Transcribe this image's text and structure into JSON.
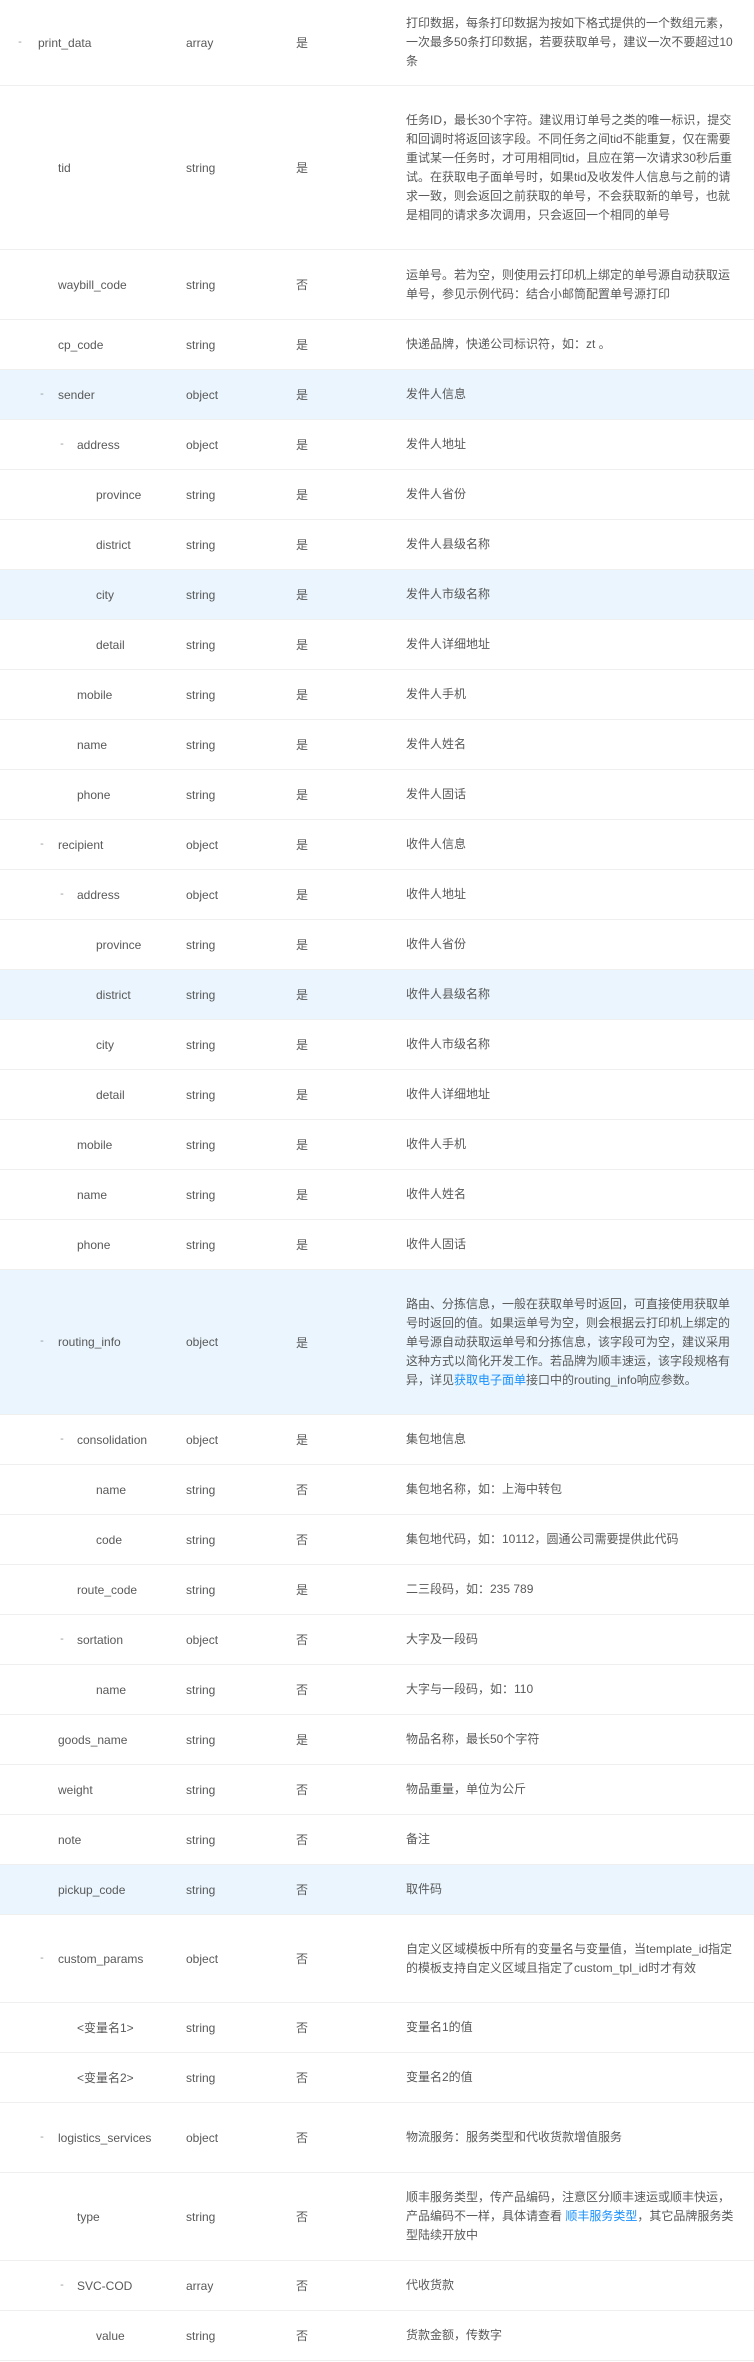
{
  "rows": [
    {
      "name": "print_data",
      "level": 0,
      "toggle": "-",
      "type": "array",
      "required": "是",
      "desc": [
        "打印数据，每条打印数据为按如下格式提供的一个数组元素，一次最多50条打印数据，若要获取单号，建议一次不要超过10条"
      ],
      "h": 86
    },
    {
      "name": "tid",
      "level": 1,
      "toggle": "",
      "type": "string",
      "required": "是",
      "desc": [
        "任务ID，最长30个字符。建议用订单号之类的唯一标识，提交和回调时将返回该字段。不同任务之间tid不能重复，仅在需要重试某一任务时，才可用相同tid，且应在第一次请求30秒后重试。在获取电子面单号时，如果tid及收发件人信息与之前的请求一致，则会返回之前获取的单号，不会获取新的单号，也就是相同的请求多次调用，只会返回一个相同的单号"
      ],
      "h": 164
    },
    {
      "name": "waybill_code",
      "level": 1,
      "toggle": "",
      "type": "string",
      "required": "否",
      "desc": [
        "运单号。若为空，则使用云打印机上绑定的单号源自动获取运单号，参见示例代码：结合小邮筒配置单号源打印"
      ],
      "h": 70
    },
    {
      "name": "cp_code",
      "level": 1,
      "toggle": "",
      "type": "string",
      "required": "是",
      "desc": [
        "快递品牌，快递公司标识符，如：zt 。"
      ],
      "h": 50
    },
    {
      "name": "sender",
      "level": 1,
      "toggle": "-",
      "type": "object",
      "required": "是",
      "desc": [
        "发件人信息"
      ],
      "h": 50,
      "hl": true
    },
    {
      "name": "address",
      "level": 2,
      "toggle": "-",
      "type": "object",
      "required": "是",
      "desc": [
        "发件人地址"
      ],
      "h": 50
    },
    {
      "name": "province",
      "level": 3,
      "toggle": "",
      "type": "string",
      "required": "是",
      "desc": [
        "发件人省份"
      ],
      "h": 50
    },
    {
      "name": "district",
      "level": 3,
      "toggle": "",
      "type": "string",
      "required": "是",
      "desc": [
        "发件人县级名称"
      ],
      "h": 50
    },
    {
      "name": "city",
      "level": 3,
      "toggle": "",
      "type": "string",
      "required": "是",
      "desc": [
        "发件人市级名称"
      ],
      "h": 50,
      "hl": true
    },
    {
      "name": "detail",
      "level": 3,
      "toggle": "",
      "type": "string",
      "required": "是",
      "desc": [
        "发件人详细地址"
      ],
      "h": 50
    },
    {
      "name": "mobile",
      "level": 2,
      "toggle": "",
      "type": "string",
      "required": "是",
      "desc": [
        "发件人手机"
      ],
      "h": 50
    },
    {
      "name": "name",
      "level": 2,
      "toggle": "",
      "type": "string",
      "required": "是",
      "desc": [
        "发件人姓名"
      ],
      "h": 50
    },
    {
      "name": "phone",
      "level": 2,
      "toggle": "",
      "type": "string",
      "required": "是",
      "desc": [
        "发件人固话"
      ],
      "h": 50
    },
    {
      "name": "recipient",
      "level": 1,
      "toggle": "-",
      "type": "object",
      "required": "是",
      "desc": [
        "收件人信息"
      ],
      "h": 50
    },
    {
      "name": "address",
      "level": 2,
      "toggle": "-",
      "type": "object",
      "required": "是",
      "desc": [
        "收件人地址"
      ],
      "h": 50
    },
    {
      "name": "province",
      "level": 3,
      "toggle": "",
      "type": "string",
      "required": "是",
      "desc": [
        "收件人省份"
      ],
      "h": 50
    },
    {
      "name": "district",
      "level": 3,
      "toggle": "",
      "type": "string",
      "required": "是",
      "desc": [
        "收件人县级名称"
      ],
      "h": 50,
      "hl": true
    },
    {
      "name": "city",
      "level": 3,
      "toggle": "",
      "type": "string",
      "required": "是",
      "desc": [
        "收件人市级名称"
      ],
      "h": 50
    },
    {
      "name": "detail",
      "level": 3,
      "toggle": "",
      "type": "string",
      "required": "是",
      "desc": [
        "收件人详细地址"
      ],
      "h": 50
    },
    {
      "name": "mobile",
      "level": 2,
      "toggle": "",
      "type": "string",
      "required": "是",
      "desc": [
        "收件人手机"
      ],
      "h": 50
    },
    {
      "name": "name",
      "level": 2,
      "toggle": "",
      "type": "string",
      "required": "是",
      "desc": [
        "收件人姓名"
      ],
      "h": 50
    },
    {
      "name": "phone",
      "level": 2,
      "toggle": "",
      "type": "string",
      "required": "是",
      "desc": [
        "收件人固话"
      ],
      "h": 50
    },
    {
      "name": "routing_info",
      "level": 1,
      "toggle": "-",
      "type": "object",
      "required": "是",
      "desc": [
        "路由、分拣信息，一般在获取单号时返回，可直接使用获取单号时返回的值。如果运单号为空，则会根据云打印机上绑定的单号源自动获取运单号和分拣信息，该字段可为空，建议采用这种方式以简化开发工作。若品牌为顺丰速运，该字段规格有异，详见",
        {
          "link": "获取电子面单"
        },
        "接口中的routing_info响应参数。"
      ],
      "h": 145,
      "hl": true
    },
    {
      "name": "consolidation",
      "level": 2,
      "toggle": "-",
      "type": "object",
      "required": "是",
      "desc": [
        "集包地信息"
      ],
      "h": 50
    },
    {
      "name": "name",
      "level": 3,
      "toggle": "",
      "type": "string",
      "required": "否",
      "desc": [
        "集包地名称，如：上海中转包"
      ],
      "h": 50
    },
    {
      "name": "code",
      "level": 3,
      "toggle": "",
      "type": "string",
      "required": "否",
      "desc": [
        "集包地代码，如：10112，圆通公司需要提供此代码"
      ],
      "h": 50
    },
    {
      "name": "route_code",
      "level": 2,
      "toggle": "",
      "type": "string",
      "required": "是",
      "desc": [
        "二三段码，如：235 789"
      ],
      "h": 50
    },
    {
      "name": "sortation",
      "level": 2,
      "toggle": "-",
      "type": "object",
      "required": "否",
      "desc": [
        "大字及一段码"
      ],
      "h": 50
    },
    {
      "name": "name",
      "level": 3,
      "toggle": "",
      "type": "string",
      "required": "否",
      "desc": [
        "大字与一段码，如：110"
      ],
      "h": 50
    },
    {
      "name": "goods_name",
      "level": 1,
      "toggle": "",
      "type": "string",
      "required": "是",
      "desc": [
        "物品名称，最长50个字符"
      ],
      "h": 50
    },
    {
      "name": "weight",
      "level": 1,
      "toggle": "",
      "type": "string",
      "required": "否",
      "desc": [
        "物品重量，单位为公斤"
      ],
      "h": 50
    },
    {
      "name": "note",
      "level": 1,
      "toggle": "",
      "type": "string",
      "required": "否",
      "desc": [
        "备注"
      ],
      "h": 50
    },
    {
      "name": "pickup_code",
      "level": 1,
      "toggle": "",
      "type": "string",
      "required": "否",
      "desc": [
        "取件码"
      ],
      "h": 50,
      "hl": true
    },
    {
      "name": "custom_params",
      "level": 1,
      "toggle": "-",
      "type": "object",
      "required": "否",
      "desc": [
        "自定义区域模板中所有的变量名与变量值，当template_id指定的模板支持自定义区域且指定了custom_tpl_id时才有效"
      ],
      "h": 88
    },
    {
      "name": "<变量名1>",
      "level": 2,
      "toggle": "",
      "type": "string",
      "required": "否",
      "desc": [
        "变量名1的值"
      ],
      "h": 50
    },
    {
      "name": "<变量名2>",
      "level": 2,
      "toggle": "",
      "type": "string",
      "required": "否",
      "desc": [
        "变量名2的值"
      ],
      "h": 50
    },
    {
      "name": "logistics_services",
      "level": 1,
      "toggle": "-",
      "type": "object",
      "required": "否",
      "desc": [
        "物流服务：服务类型和代收货款增值服务"
      ],
      "h": 70
    },
    {
      "name": "type",
      "level": 2,
      "toggle": "",
      "type": "string",
      "required": "否",
      "desc": [
        "顺丰服务类型，传产品编码，注意区分顺丰速运或顺丰快运，产品编码不一样，具体请查看 ",
        {
          "link": "顺丰服务类型"
        },
        "，其它品牌服务类型陆续开放中"
      ],
      "h": 88
    },
    {
      "name": "SVC-COD",
      "level": 2,
      "toggle": "-",
      "type": "array",
      "required": "否",
      "desc": [
        "代收货款"
      ],
      "h": 50
    },
    {
      "name": "value",
      "level": 3,
      "toggle": "",
      "type": "string",
      "required": "否",
      "desc": [
        "货款金额，传数字"
      ],
      "h": 50
    }
  ]
}
